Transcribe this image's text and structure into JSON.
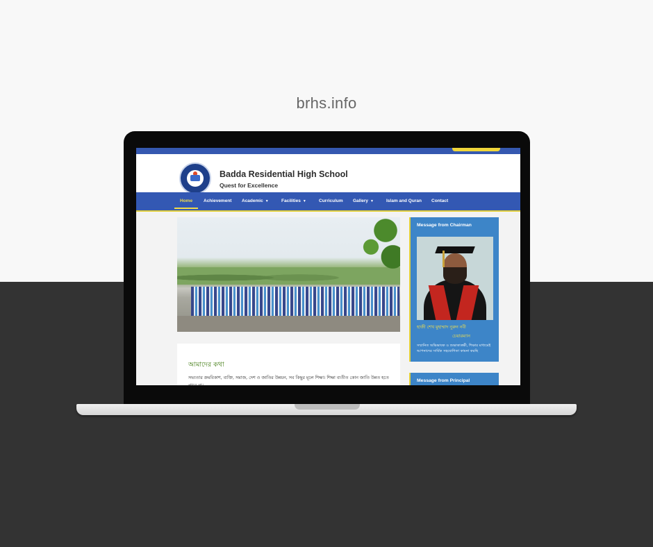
{
  "domain_caption": "brhs.info",
  "site": {
    "school_name": "Badda Residential High School",
    "tagline": "Quest for Excellence"
  },
  "nav": {
    "items": [
      {
        "label": "Home",
        "active": true
      },
      {
        "label": "Achievement"
      },
      {
        "label": "Academic",
        "dropdown": true
      },
      {
        "label": "Facilities",
        "dropdown": true
      },
      {
        "label": "Curriculum"
      },
      {
        "label": "Gallery",
        "dropdown": true
      },
      {
        "label": "Islam and Quran"
      },
      {
        "label": "Contact"
      }
    ],
    "caret": "▼"
  },
  "slider": {
    "slide_count": 5,
    "active_index": 1
  },
  "about": {
    "title": "আমাদের কথা",
    "text": "সভ্যতার ক্রমবিকাশ, ব্যক্তি, সমাজ, দেশ ও জাতির উন্নয়ন, সব কিছুর মূলে শিক্ষা। শিক্ষা ব্যতীত কোন জাতি উন্নত হতে পারে না।"
  },
  "sidebar": {
    "chairman": {
      "title": "Message from Chairman",
      "name": "হাজী শেখ মুহাম্মাদ নুরুন নবী",
      "role": "চেয়ারম্যান",
      "message": "সম্মানিত অভিভাবক ও শুভাকাঙ্ক্ষী, শিক্ষার মাধ্যমেই আপনাদের সার্বিক সহযোগিতা কামনা করছি"
    },
    "principal": {
      "title": "Message from Principal"
    }
  },
  "colors": {
    "nav_bg": "#3358b3",
    "accent_yellow": "#f2dc49",
    "sidebar_bg": "#3d85c8",
    "about_title": "#3f7a10"
  }
}
